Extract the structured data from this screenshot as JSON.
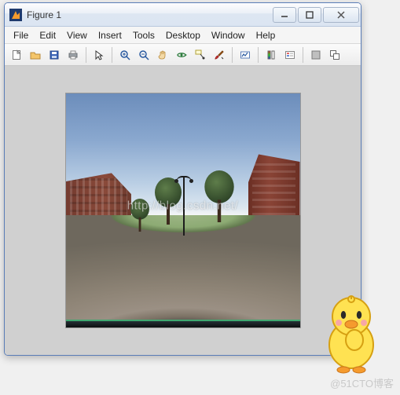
{
  "window": {
    "title": "Figure 1"
  },
  "menu": {
    "file": "File",
    "edit": "Edit",
    "view": "View",
    "insert": "Insert",
    "tools": "Tools",
    "desktop": "Desktop",
    "window": "Window",
    "help": "Help"
  },
  "toolbar_icons": {
    "new": "new-file-icon",
    "open": "open-folder-icon",
    "save": "save-icon",
    "print": "print-icon",
    "pointer": "pointer-icon",
    "zoom_in": "zoom-in-icon",
    "zoom_out": "zoom-out-icon",
    "pan": "pan-hand-icon",
    "rotate": "rotate-3d-icon",
    "data_cursor": "data-cursor-icon",
    "brush": "brush-icon",
    "link": "link-plot-icon",
    "colorbar": "insert-colorbar-icon",
    "legend": "insert-legend-icon",
    "hide_tools": "hide-tools-icon",
    "dock": "dock-figure-icon"
  },
  "watermarks": {
    "center": "http://blog.csdn.net/",
    "corner": "@51CTO博客"
  }
}
